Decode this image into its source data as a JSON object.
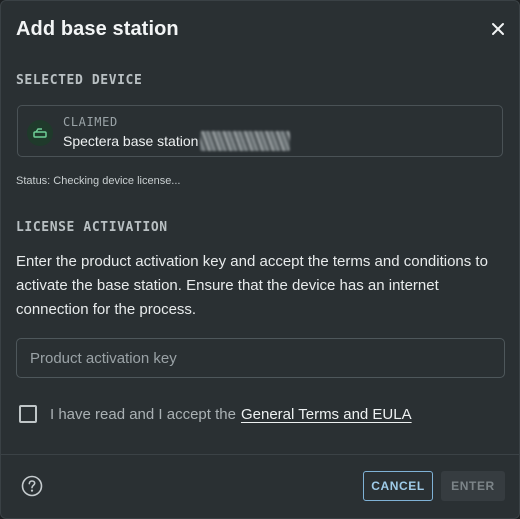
{
  "dialog": {
    "title": "Add base station",
    "close_icon": "close-icon"
  },
  "selected_device": {
    "section_label": "SELECTED DEVICE",
    "status": "CLAIMED",
    "name": "Spectera base station",
    "name_suffix_redacted": true,
    "icon": "base-station-icon",
    "icon_color": "#6fcf97"
  },
  "status_line": "Status: Checking device license...",
  "license": {
    "section_label": "LICENSE ACTIVATION",
    "instructions": "Enter the product activation key and accept the terms and conditions to activate the base station. Ensure that the device has an internet connection for the process.",
    "input_placeholder": "Product activation key",
    "input_value": "",
    "terms_text": "I have read and I accept the",
    "terms_link": "General Terms and EULA",
    "terms_checked": false
  },
  "footer": {
    "help_icon": "help-circle-icon",
    "cancel_label": "CANCEL",
    "enter_label": "ENTER"
  },
  "colors": {
    "background": "#2a3033",
    "accent": "#9fcbe8",
    "disabled_button": "#363c40"
  }
}
